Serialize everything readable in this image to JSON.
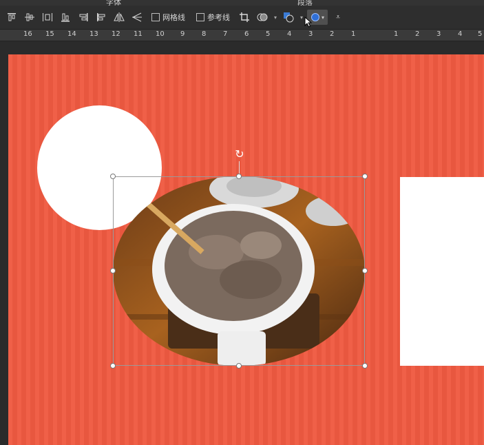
{
  "ribbon": {
    "group_labels": [
      "字体",
      "段落"
    ]
  },
  "toolbar": {
    "gridlines_label": "网格线",
    "guides_label": "参考线"
  },
  "ruler": {
    "numbers": [
      "16",
      "15",
      "14",
      "13",
      "12",
      "11",
      "10",
      "9",
      "8",
      "7",
      "6",
      "5",
      "4",
      "3",
      "2",
      "1",
      "",
      "1",
      "2",
      "3",
      "4",
      "5"
    ]
  },
  "slide": {
    "background_color": "#ef5a41",
    "shapes": [
      "white-circle",
      "white-rectangle",
      "oval-photo"
    ],
    "photo_description_icon": "oval-cropped-photo"
  }
}
